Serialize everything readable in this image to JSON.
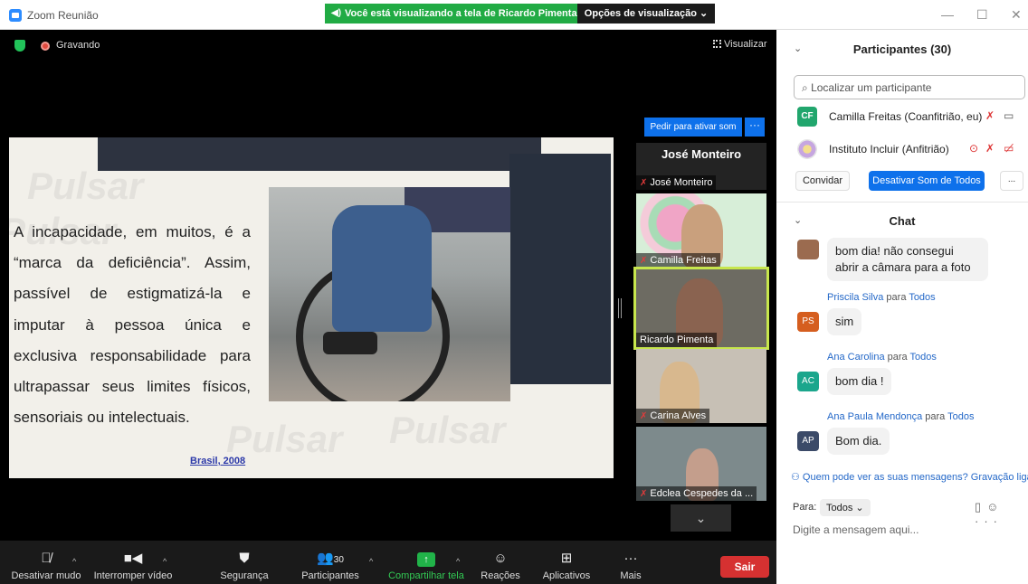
{
  "window": {
    "title": "Zoom Reunião",
    "share_banner": "Você está visualizando a tela de Ricardo Pimenta",
    "view_options": "Opções de visualização"
  },
  "meeting": {
    "recording_label": "Gravando",
    "view_label": "Visualizar"
  },
  "slide": {
    "paragraph": "A incapacidade, em muitos, é a “marca da deficiência”. Assim, passível de estigmatizá-la e imputar à pessoa única e exclusiva responsabilidade para ultrapassar seus limites físicos, sensoriais ou intelectuais.",
    "citation": "Brasil, 2008",
    "watermark": "Pulsar"
  },
  "thumbnails": {
    "ask_unmute": "Pedir para ativar som",
    "more": "···",
    "items": [
      {
        "name": "José Monteiro",
        "label": "José Monteiro"
      },
      {
        "label": "Camilla Freitas"
      },
      {
        "label": "Ricardo Pimenta"
      },
      {
        "label": "Carina Alves"
      },
      {
        "label": "Edclea Cespedes da ..."
      }
    ]
  },
  "toolbar": {
    "mute": "Desativar mudo",
    "stop_video": "Interromper vídeo",
    "security": "Segurança",
    "participants": "Participantes",
    "participants_count": "30",
    "share": "Compartilhar tela",
    "reactions": "Reações",
    "apps": "Aplicativos",
    "more": "Mais",
    "leave": "Sair"
  },
  "participants_panel": {
    "title": "Participantes (30)",
    "search_placeholder": "Localizar um participante",
    "rows": [
      {
        "initials": "CF",
        "name": "Camilla Freitas (Coanfitrião, eu)"
      },
      {
        "initials": "",
        "name": "Instituto Incluir (Anfitrião)"
      }
    ],
    "invite": "Convidar",
    "mute_all": "Desativar Som de Todos",
    "more": "..."
  },
  "chat_panel": {
    "title": "Chat",
    "messages": [
      {
        "initials": "",
        "sender": "",
        "to": "",
        "recipient": "",
        "text": "bom dia! não consegui abrir a câmara para a foto"
      },
      {
        "initials": "PS",
        "sender": "Priscila Silva",
        "to": "para",
        "recipient": "Todos",
        "text": "sim"
      },
      {
        "initials": "AC",
        "sender": "Ana Carolina",
        "to": "para",
        "recipient": "Todos",
        "text": "bom dia !"
      },
      {
        "initials": "AP",
        "sender": "Ana Paula Mendonça",
        "to": "para",
        "recipient": "Todos",
        "text": "Bom dia."
      }
    ],
    "privacy": "Quem pode ver as suas mensagens? Gravação ligada",
    "to_label": "Para:",
    "to_value": "Todos",
    "compose_placeholder": "Digite a mensagem aqui..."
  },
  "colors": {
    "accent": "#0e71eb",
    "banner_green": "#21ab44",
    "leave_red": "#d63131",
    "active_speaker": "#c7e64d"
  }
}
